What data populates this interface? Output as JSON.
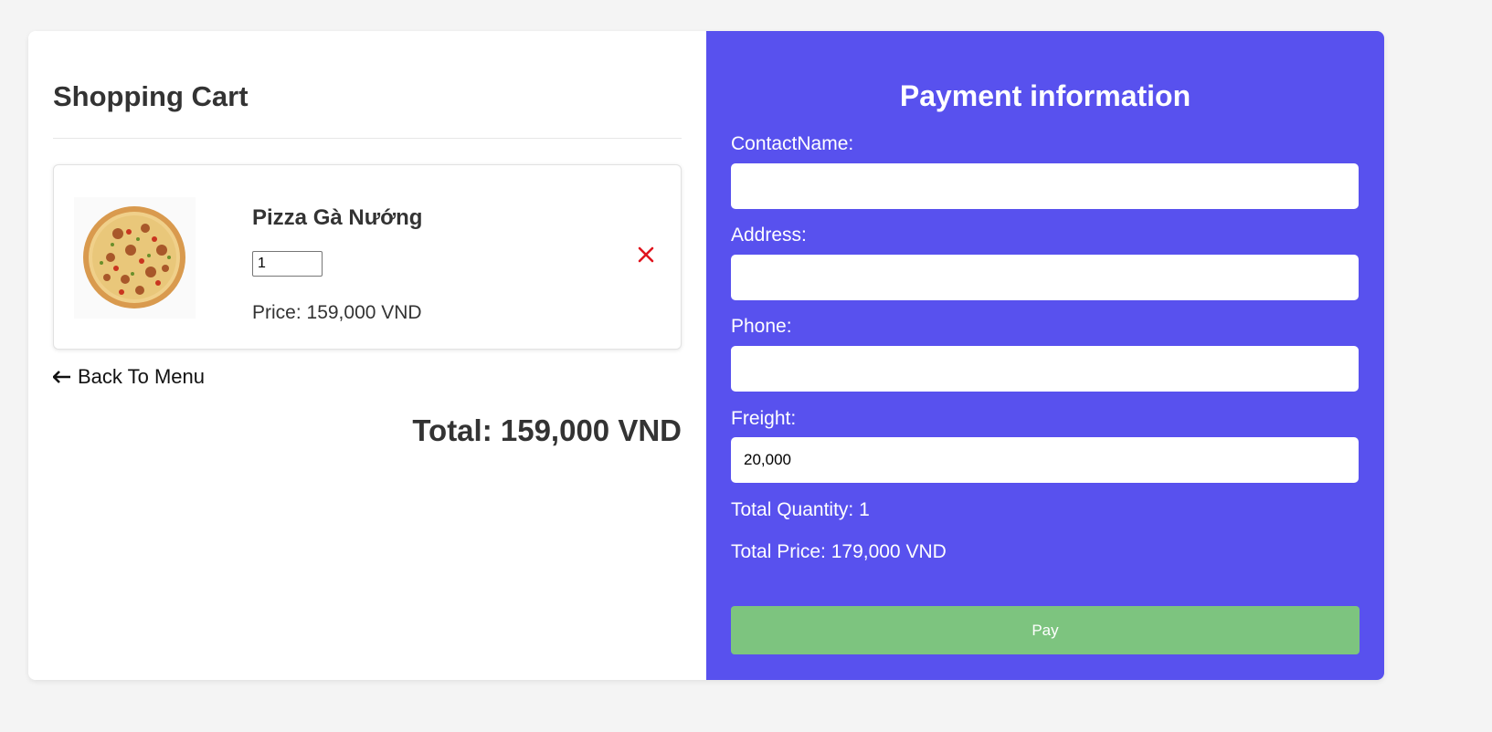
{
  "cart": {
    "title": "Shopping Cart",
    "items": [
      {
        "name": "Pizza Gà Nướng",
        "quantity": "1",
        "price_text": "Price: 159,000 VND",
        "image_icon": "pizza-image",
        "remove_icon": "close-icon"
      }
    ],
    "back_label": "Back To Menu",
    "back_icon": "arrow-left-icon",
    "total_text": "Total: 159,000 VND"
  },
  "payment": {
    "title": "Payment information",
    "fields": {
      "contact_name": {
        "label": "ContactName:",
        "value": ""
      },
      "address": {
        "label": "Address:",
        "value": ""
      },
      "phone": {
        "label": "Phone:",
        "value": ""
      },
      "freight": {
        "label": "Freight:",
        "value": "20,000"
      }
    },
    "total_quantity_text": "Total Quantity: 1",
    "total_price_text": "Total Price: 179,000 VND",
    "pay_label": "Pay"
  },
  "colors": {
    "background": "#f4f4f4",
    "payment_panel": "#5851ee",
    "pay_button": "#7dc47f",
    "remove_icon": "#e0141e"
  }
}
